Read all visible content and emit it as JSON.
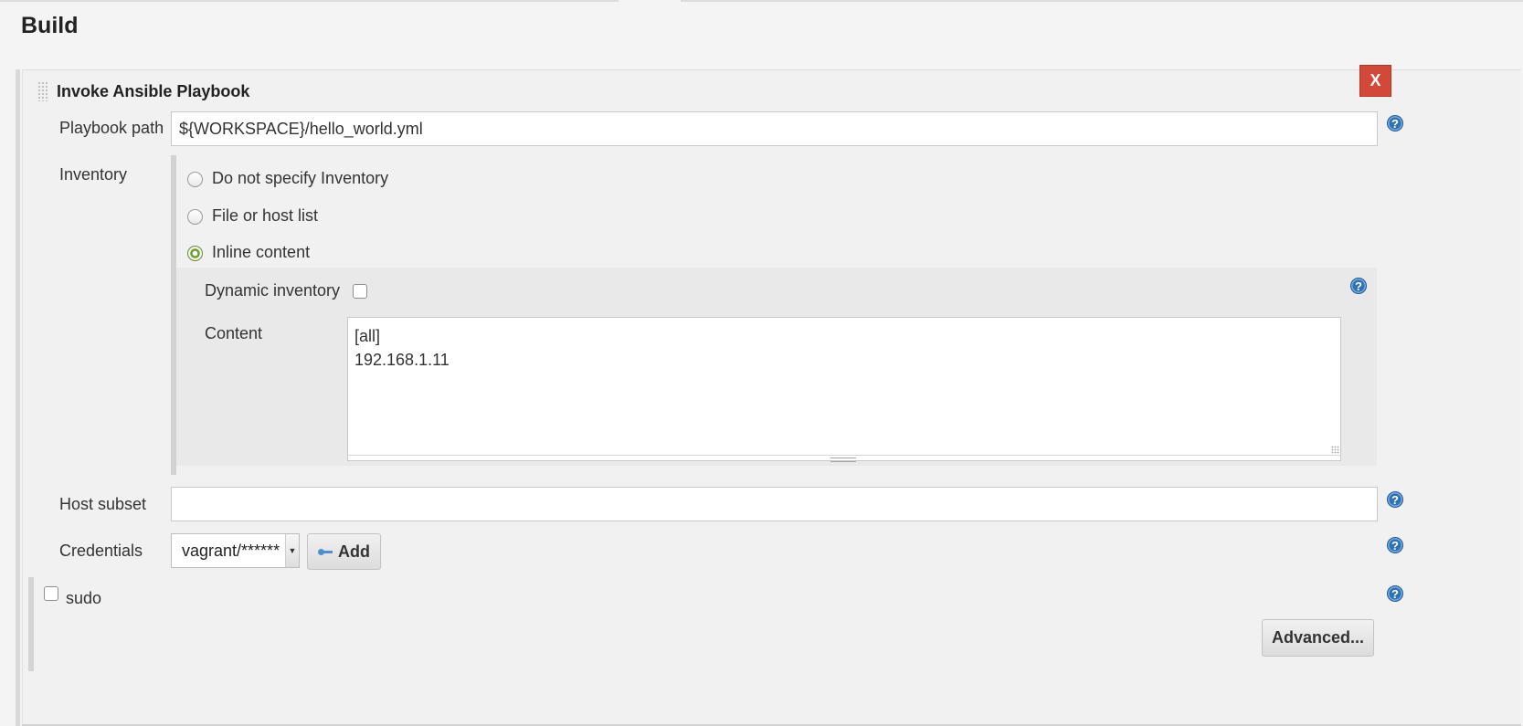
{
  "section": {
    "title": "Build"
  },
  "step": {
    "title": "Invoke Ansible Playbook",
    "delete_label": "X"
  },
  "playbook": {
    "label": "Playbook path",
    "value": "${WORKSPACE}/hello_world.yml"
  },
  "inventory": {
    "label": "Inventory",
    "options": [
      {
        "label": "Do not specify Inventory",
        "selected": false
      },
      {
        "label": "File or host list",
        "selected": false
      },
      {
        "label": "Inline content",
        "selected": true
      }
    ],
    "dynamic": {
      "label": "Dynamic inventory",
      "checked": false
    },
    "content": {
      "label": "Content",
      "value": "[all]\n192.168.1.11"
    }
  },
  "host_subset": {
    "label": "Host subset",
    "value": ""
  },
  "credentials": {
    "label": "Credentials",
    "selected": "vagrant/******",
    "add_label": "Add"
  },
  "sudo": {
    "label": "sudo",
    "checked": false
  },
  "advanced_label": "Advanced...",
  "help_glyph": "?",
  "icons": {
    "help": "help-icon",
    "key": "key-icon",
    "drag": "drag-handle-icon"
  },
  "colors": {
    "delete": "#d24939",
    "help": "#2f72b4",
    "radio_checked": "#6aa22a"
  }
}
